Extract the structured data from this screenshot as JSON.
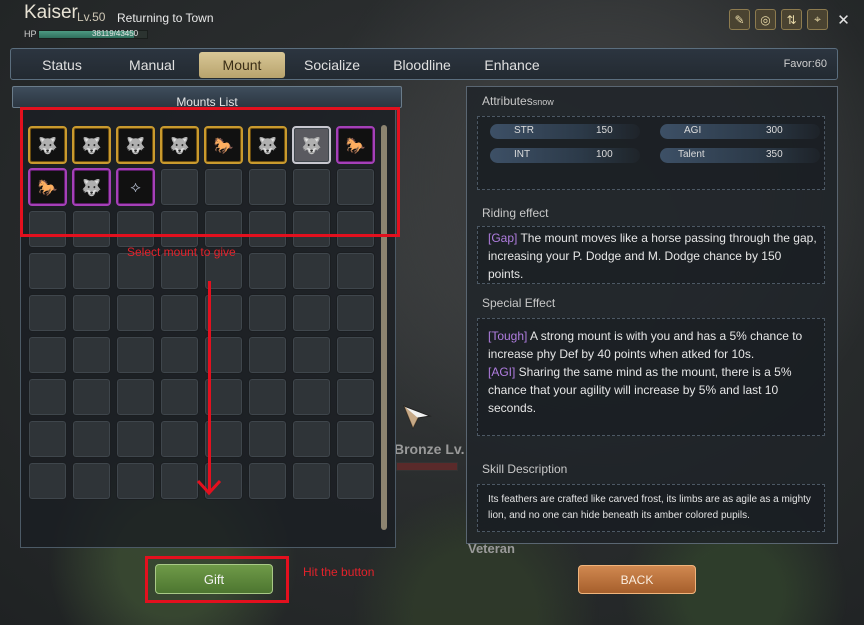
{
  "character": {
    "name": "Kaiser",
    "level": "Lv.50",
    "status": "Returning to Town",
    "hp_label": "HP",
    "hp_text": "38119/43450",
    "hp_ratio": 0.877
  },
  "top_icons": [
    "edit-icon",
    "target-icon",
    "swap-icon",
    "crosshair-icon",
    "close-icon"
  ],
  "tabs": [
    {
      "label": "Status",
      "active": false
    },
    {
      "label": "Manual",
      "active": false
    },
    {
      "label": "Mount",
      "active": true
    },
    {
      "label": "Socialize",
      "active": false
    },
    {
      "label": "Bloodline",
      "active": false
    },
    {
      "label": "Enhance",
      "active": false
    }
  ],
  "favor": "Favor:60",
  "mounts_list": {
    "title": "Mounts List",
    "slots": [
      {
        "rarity": "gold",
        "icon": "wolf-icon"
      },
      {
        "rarity": "gold",
        "icon": "wolf-icon"
      },
      {
        "rarity": "gold",
        "icon": "wolf-icon"
      },
      {
        "rarity": "gold",
        "icon": "wolf-icon"
      },
      {
        "rarity": "gold",
        "icon": "horse-icon"
      },
      {
        "rarity": "gold",
        "icon": "wolf-icon"
      },
      {
        "rarity": "silver",
        "icon": "wolf-icon"
      },
      {
        "rarity": "purple",
        "icon": "horse-icon"
      },
      {
        "rarity": "purple",
        "icon": "horse-icon"
      },
      {
        "rarity": "purple",
        "icon": "wolf-icon"
      },
      {
        "rarity": "purple",
        "icon": "dragonfly-icon"
      }
    ],
    "total_slots": 72
  },
  "annotations": {
    "select_text": "Select mount to give",
    "hit_text": "Hit the button"
  },
  "buttons": {
    "gift": "Gift",
    "back": "BACK"
  },
  "attributes": {
    "title": "Attributes",
    "subtitle": "snow",
    "items": [
      {
        "key": "STR",
        "value": "150"
      },
      {
        "key": "AGI",
        "value": "300"
      },
      {
        "key": "INT",
        "value": "100"
      },
      {
        "key": "Talent",
        "value": "350"
      }
    ]
  },
  "riding_effect": {
    "title": "Riding effect",
    "tag": "[Gap]",
    "text": " The mount moves like a horse passing through the gap, increasing your P. Dodge and M. Dodge chance by 150 points."
  },
  "special_effect": {
    "title": "Special Effect",
    "tag1": "[Tough]",
    "text1": " A strong mount is with you and has a 5% chance to increase phy Def by 40 points when atked for 10s.",
    "tag2": "[AGI]",
    "text2": " Sharing the same mind as the mount, there is a 5% chance that your agility will increase by 5% and last 10 seconds."
  },
  "skill_description": {
    "title": "Skill Description",
    "text": "Its feathers are crafted like carved frost, its limbs are as agile as a mighty lion, and no one can hide beneath its amber colored pupils."
  },
  "world": {
    "label1": "Bronze Lv.",
    "label2": "Veteran"
  }
}
